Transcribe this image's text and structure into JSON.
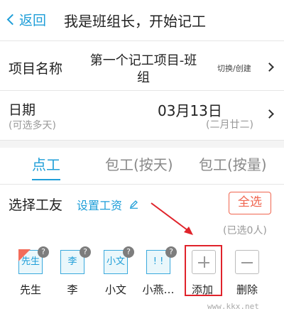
{
  "header": {
    "back_label": "返回",
    "title": "我是班组长，开始记工"
  },
  "project": {
    "label": "项目名称",
    "value_line1": "第一个记工项目-班",
    "value_line2": "组",
    "switch_label": "切换/创建"
  },
  "date": {
    "label": "日期",
    "hint": "(可选多天)",
    "value": "03月13日",
    "lunar": "(二月廿二)"
  },
  "tabs": [
    {
      "label": "点工",
      "active": true
    },
    {
      "label": "包工(按天)",
      "active": false
    },
    {
      "label": "包工(按量)",
      "active": false
    }
  ],
  "workers_section": {
    "title": "选择工友",
    "set_wage_label": "设置工资",
    "select_all_label": "全选",
    "selected_count": "(已选0人)",
    "workers": [
      {
        "tile": "先生",
        "name": "先生"
      },
      {
        "tile": "李",
        "name": "李"
      },
      {
        "tile": "小文",
        "name": "小文"
      },
      {
        "tile": "! !",
        "name": "小燕…"
      }
    ],
    "add_label": "添加",
    "delete_label": "删除"
  },
  "watermark": "www.kkx.net",
  "colors": {
    "accent": "#1e9ed8",
    "danger": "#f0654f",
    "annotation": "#e0232b"
  }
}
